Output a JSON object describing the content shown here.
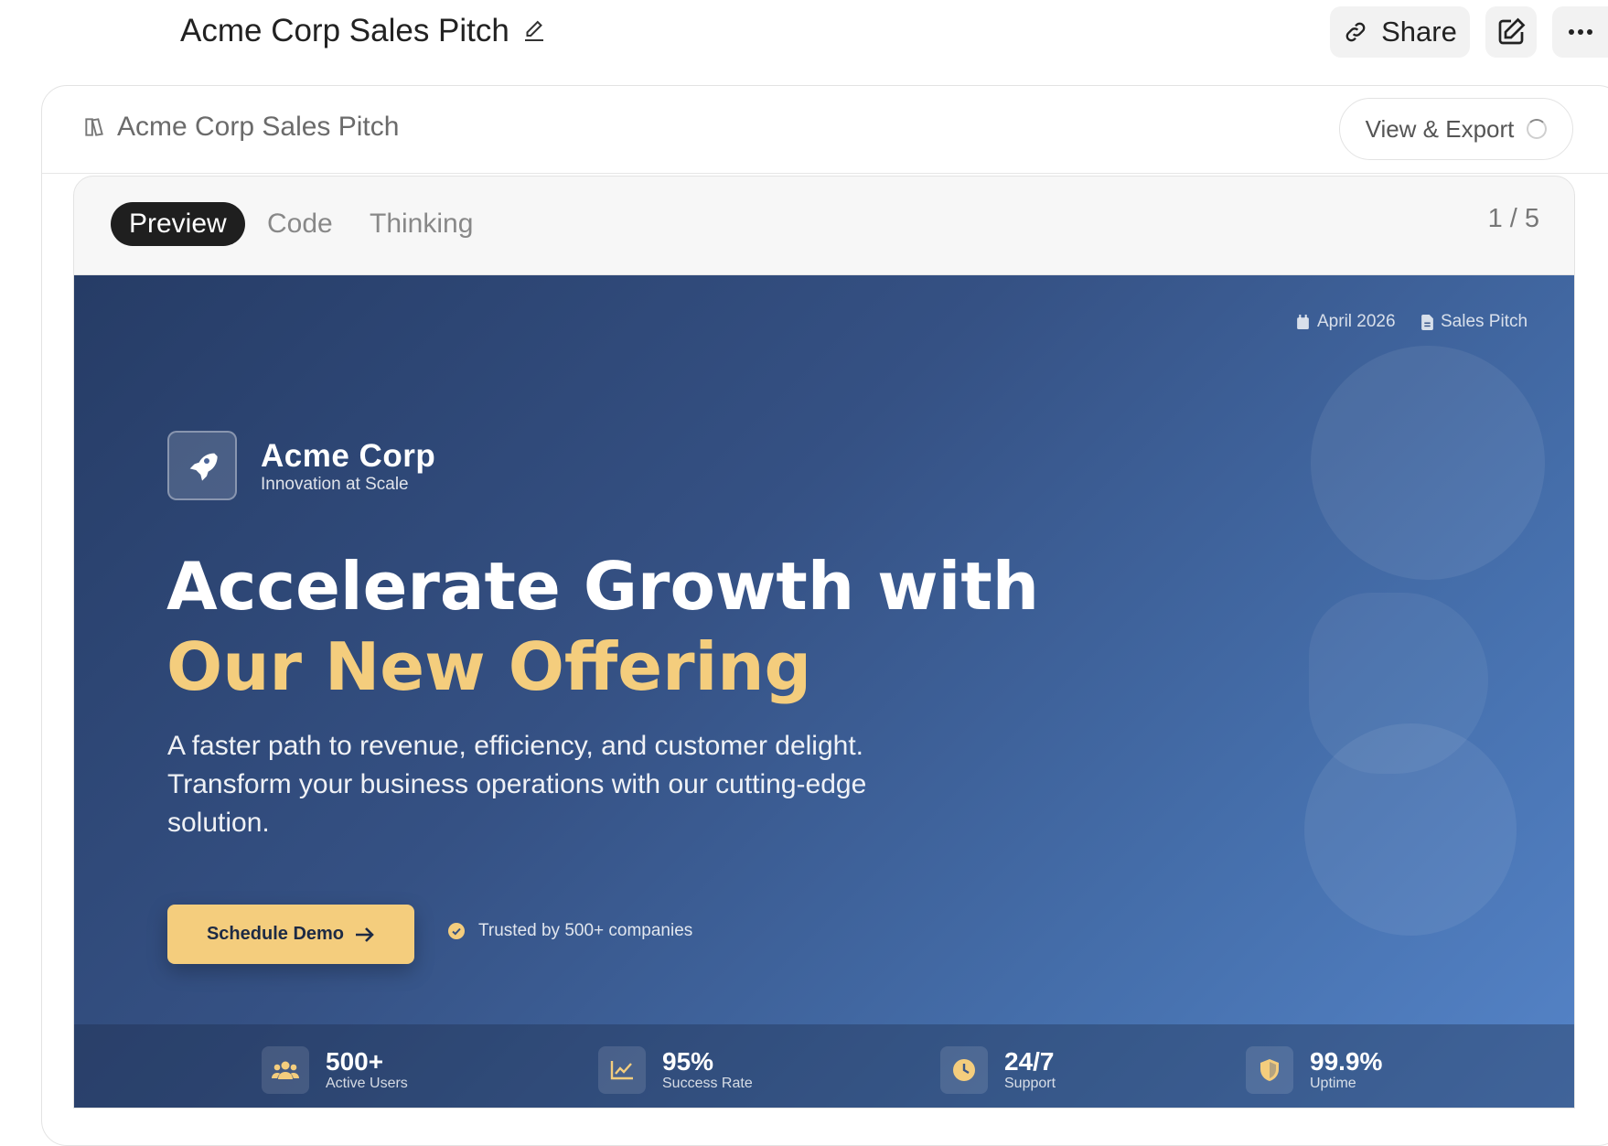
{
  "topbar": {
    "title": "Acme Corp Sales Pitch",
    "share_label": "Share"
  },
  "artifact": {
    "title": "Acme Corp Sales Pitch",
    "export_label": "View & Export",
    "tabs": [
      {
        "label": "Preview",
        "active": true
      },
      {
        "label": "Code",
        "active": false
      },
      {
        "label": "Thinking",
        "active": false
      }
    ],
    "page_indicator": "1 / 5"
  },
  "slide": {
    "meta_date": "April 2026",
    "meta_type": "Sales Pitch",
    "brand_name": "Acme Corp",
    "brand_tagline": "Innovation at Scale",
    "headline_line1": "Accelerate Growth with",
    "headline_line2": "Our New Offering",
    "subtext": "A faster path to revenue, efficiency, and customer delight. Transform your business operations with our cutting-edge solution.",
    "cta_label": "Schedule Demo",
    "trusted_text": "Trusted by 500+ companies",
    "stats": [
      {
        "value": "500+",
        "label": "Active Users",
        "icon": "users-icon"
      },
      {
        "value": "95%",
        "label": "Success Rate",
        "icon": "chart-line-icon"
      },
      {
        "value": "24/7",
        "label": "Support",
        "icon": "clock-icon"
      },
      {
        "value": "99.9%",
        "label": "Uptime",
        "icon": "shield-icon"
      }
    ],
    "colors": {
      "accent": "#f4cd7d",
      "bg_start": "#263c66",
      "bg_end": "#5584c8"
    }
  }
}
